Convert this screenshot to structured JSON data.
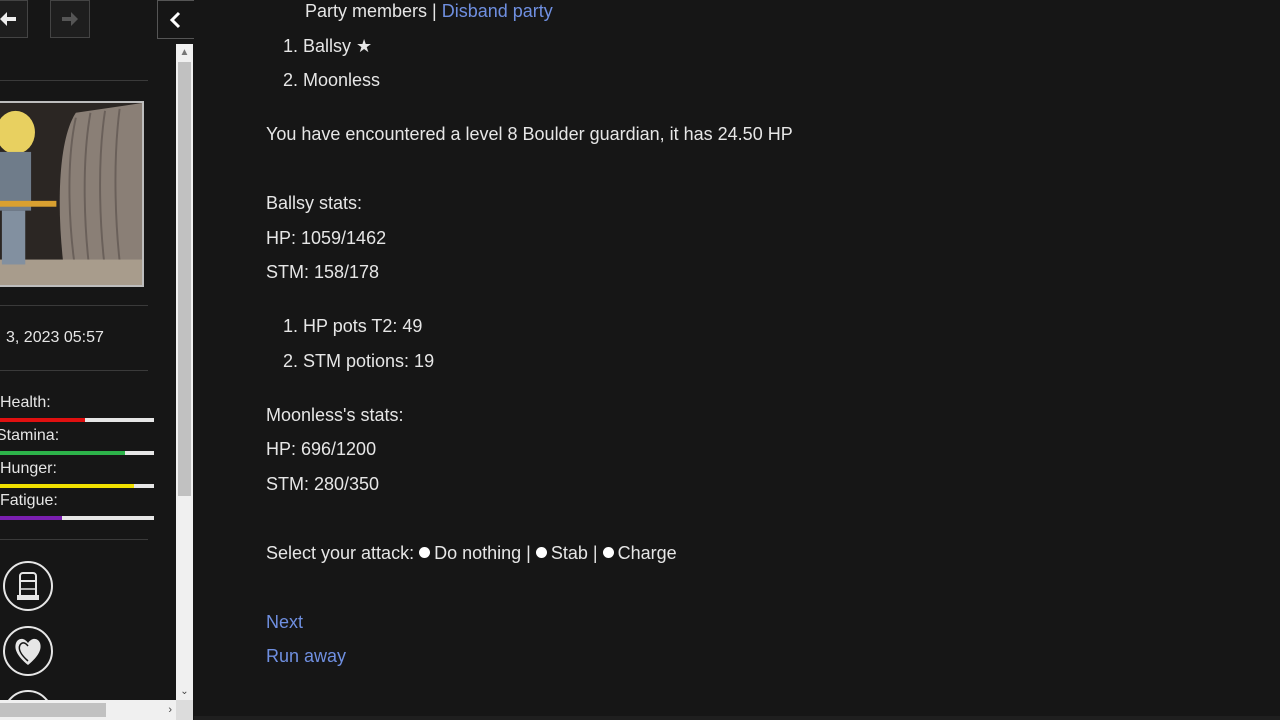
{
  "sidebar": {
    "datetime": "3, 2023 05:57",
    "bars": [
      {
        "label": "Health:",
        "percent": 55,
        "color": "#e01010"
      },
      {
        "label": "Stamina:",
        "percent": 81,
        "color": "#2db34a"
      },
      {
        "label": "Hunger:",
        "percent": 87,
        "color": "#f0e000"
      },
      {
        "label": "Fatigue:",
        "percent": 40,
        "color": "#7a1fb0"
      }
    ],
    "icons": [
      "backpack-icon",
      "heart-icon",
      "circle-icon"
    ]
  },
  "party": {
    "header_prefix": "Party members | ",
    "disband_link": "Disband party",
    "members": [
      "1. Ballsy ★",
      "2. Moonless"
    ]
  },
  "encounter": "You have encountered a level 8 Boulder guardian, it has 24.50 HP",
  "ballsy": {
    "title": "Ballsy stats:",
    "hp": "HP: 1059/1462",
    "stm": "STM: 158/178",
    "items": [
      "1. HP pots T2: 49",
      "2. STM potions: 19"
    ]
  },
  "moonless": {
    "title": "Moonless's stats:",
    "hp": "HP: 696/1200",
    "stm": "STM: 280/350"
  },
  "attack": {
    "label": "Select your attack:",
    "options": [
      "Do nothing",
      "Stab",
      "Charge"
    ],
    "separator": " | "
  },
  "actions": {
    "next": "Next",
    "run_away": "Run away"
  }
}
